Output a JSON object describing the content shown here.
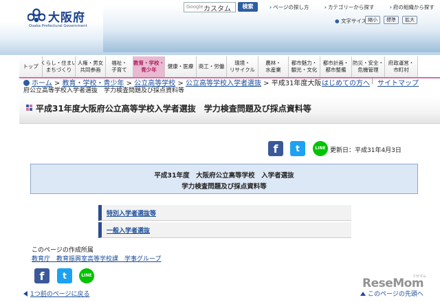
{
  "header": {
    "logo_text": "大阪府",
    "logo_sub": "Osaka Prefectural Government",
    "search_engine_label": "Google",
    "search_value": "カスタム",
    "search_button": "検索",
    "top_links": [
      "ページの探し方",
      "カテゴリーから探す",
      "府の組織から探す"
    ],
    "font_size_label": "文字サイズ:",
    "font_size_buttons": [
      "縮小",
      "標準",
      "拡大"
    ]
  },
  "nav": {
    "items": [
      {
        "l1": "トップ",
        "l2": ""
      },
      {
        "l1": "くらし・住まい",
        "l2": "まちづくり"
      },
      {
        "l1": "人権・男女",
        "l2": "共同参画"
      },
      {
        "l1": "福祉・",
        "l2": "子育て"
      },
      {
        "l1": "教育・学校・",
        "l2": "青少年"
      },
      {
        "l1": "健康・医療",
        "l2": ""
      },
      {
        "l1": "商工・労働",
        "l2": ""
      },
      {
        "l1": "環境・",
        "l2": "リサイクル"
      },
      {
        "l1": "農林・",
        "l2": "水産業"
      },
      {
        "l1": "都市魅力・",
        "l2": "観光・文化"
      },
      {
        "l1": "都市計画・",
        "l2": "都市整備"
      },
      {
        "l1": "防災・安全・",
        "l2": "危機管理"
      },
      {
        "l1": "府政運営・",
        "l2": "市町村"
      }
    ]
  },
  "breadcrumb": {
    "items": [
      "ホーム",
      "教育・学校・青少年",
      "公立高等学校",
      "公立高等学校入学者選抜"
    ],
    "current_part1": "平成31年度大阪",
    "current_part2": "府公立高等学校入学者選抜　学力検査問題及び採点資料等",
    "beginner_link": "はじめての方へ",
    "sitemap_link": "サイトマップ"
  },
  "page": {
    "title": "平成31年度大阪府公立高等学校入学者選抜　学力検査問題及び採点資料等",
    "updated": "更新日：平成31年4月3日",
    "box_line1": "平成31年度　大阪府公立高等学校　入学者選抜",
    "box_line2": "学力検査問題及び採点資料等",
    "sections": [
      "特別入学者選抜等",
      "一般入学者選抜"
    ]
  },
  "footer": {
    "maker_label": "このページの作成所属",
    "maker_link": "教育庁　教育振興室高等学校課　学事グループ",
    "back_link": "1つ前のページに戻る",
    "top_link": "このページの先頭へ",
    "watermark": "ReseMom",
    "watermark_sub": "リセマム"
  },
  "colors": {
    "brand_blue": "#2d5d9f",
    "nav_active": "#e9b9d1",
    "nav_accent": "#d86ea2",
    "facebook": "#3b5998",
    "twitter": "#1da1f2",
    "line": "#00c300"
  },
  "icons": [
    "facebook-icon",
    "twitter-icon",
    "line-icon"
  ]
}
